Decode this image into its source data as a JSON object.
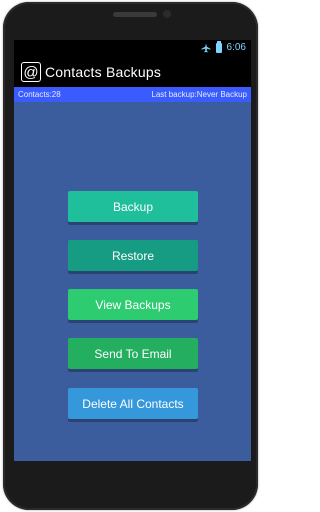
{
  "status_bar": {
    "time": "6:06",
    "icons": [
      "airplane-icon",
      "battery-icon"
    ]
  },
  "app_bar": {
    "icon_glyph": "@",
    "title": "Contacts Backups"
  },
  "info_bar": {
    "contacts": "Contacts:28",
    "last_backup": "Last backup:Never Backup"
  },
  "buttons": [
    {
      "label": "Backup",
      "color": "#1fbf9c"
    },
    {
      "label": "Restore",
      "color": "#179c84"
    },
    {
      "label": "View Backups",
      "color": "#2ecc71"
    },
    {
      "label": "Send To Email",
      "color": "#24ae5f"
    },
    {
      "label": "Delete All Contacts",
      "color": "#3498db"
    }
  ],
  "colors": {
    "content_bg": "#3b5d9e",
    "info_bar_bg": "#3a5cff"
  }
}
